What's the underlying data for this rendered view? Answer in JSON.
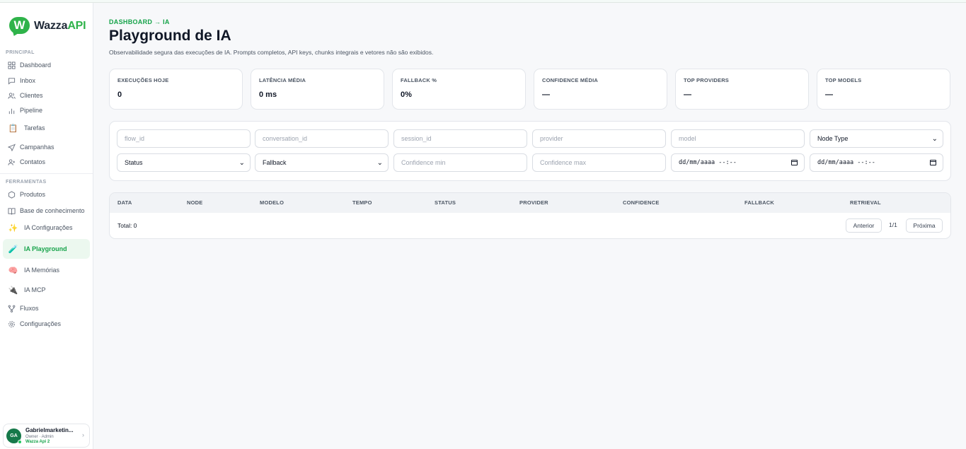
{
  "brand": {
    "name_main": "Wazza",
    "name_accent": "API",
    "mark_letter": "W"
  },
  "sidebar": {
    "sections": {
      "principal": "PRINCIPAL",
      "ferramentas": "FERRAMENTAS"
    },
    "items": [
      {
        "label": "Dashboard",
        "icon": "grid-icon"
      },
      {
        "label": "Inbox",
        "icon": "chat-icon"
      },
      {
        "label": "Clientes",
        "icon": "users-icon"
      },
      {
        "label": "Pipeline",
        "icon": "bar-chart-icon"
      },
      {
        "label": "Tarefas",
        "icon": "clipboard-icon"
      },
      {
        "label": "Campanhas",
        "icon": "send-icon"
      },
      {
        "label": "Contatos",
        "icon": "user-plus-icon"
      },
      {
        "label": "Produtos",
        "icon": "box-icon"
      },
      {
        "label": "Base de conhecimento",
        "icon": "book-icon"
      },
      {
        "label": "IA Configurações",
        "icon": "sparkles-icon"
      },
      {
        "label": "IA Playground",
        "icon": "test-tube-icon",
        "active": true
      },
      {
        "label": "IA Memórias",
        "icon": "brain-icon"
      },
      {
        "label": "IA MCP",
        "icon": "plug-icon"
      },
      {
        "label": "Fluxos",
        "icon": "flow-icon"
      },
      {
        "label": "Configurações",
        "icon": "gear-icon"
      }
    ],
    "user": {
      "initials": "GA",
      "name": "Gabrielmarketin...",
      "role": "Owner · Admin",
      "org": "Wazza Api 2"
    }
  },
  "header": {
    "breadcrumb": "DASHBOARD → IA",
    "title": "Playground de IA",
    "subtitle": "Observabilidade segura das execuções de IA. Prompts completos, API keys, chunks integrais e vetores não são exibidos."
  },
  "stats": [
    {
      "label": "EXECUÇÕES HOJE",
      "value": "0"
    },
    {
      "label": "LATÊNCIA MÉDIA",
      "value": "0 ms"
    },
    {
      "label": "FALLBACK %",
      "value": "0%"
    },
    {
      "label": "CONFIDENCE MÉDIA",
      "value": "—"
    },
    {
      "label": "TOP PROVIDERS",
      "value": "—"
    },
    {
      "label": "TOP MODELS",
      "value": "—"
    }
  ],
  "filters": {
    "flow_id": "flow_id",
    "conversation_id": "conversation_id",
    "session_id": "session_id",
    "provider": "provider",
    "model": "model",
    "node_type": "Node Type",
    "status": "Status",
    "fallback": "Fallback",
    "confidence_min": "Confidence min",
    "confidence_max": "Confidence max",
    "date_from": "dd/mm/aaaa --:--",
    "date_to": "dd/mm/aaaa --:--"
  },
  "table": {
    "columns": [
      "DATA",
      "NODE",
      "MODELO",
      "TEMPO",
      "STATUS",
      "PROVIDER",
      "CONFIDENCE",
      "FALLBACK",
      "RETRIEVAL"
    ],
    "rows": [],
    "total": "Total: 0",
    "prev": "Anterior",
    "page": "1/1",
    "next": "Próxima"
  },
  "colors": {
    "accent": "#16a34a",
    "brand_green": "#2fb34a",
    "active_bg": "#ecf8ef"
  }
}
